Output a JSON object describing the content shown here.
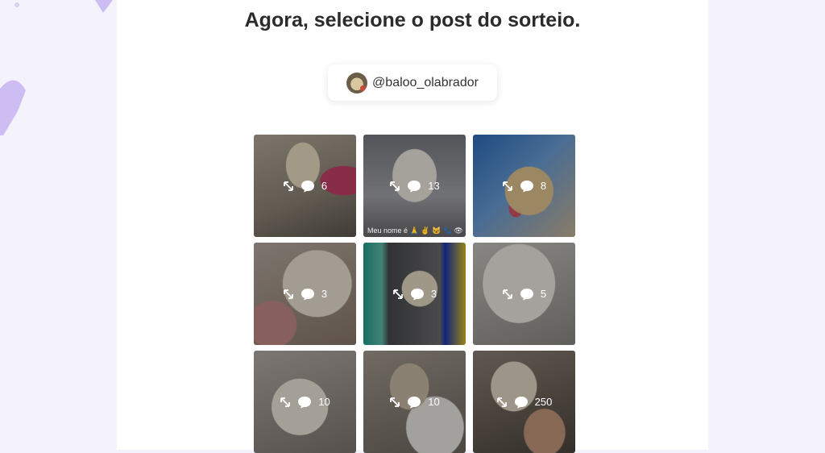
{
  "page": {
    "title": "Agora, selecione o post do sorteio."
  },
  "account": {
    "handle": "@baloo_olabrador"
  },
  "posts": [
    {
      "comments": "6"
    },
    {
      "comments": "13",
      "caption": "Meu nome é 🙏 ✌ 🐱 🐾 👁"
    },
    {
      "comments": "8"
    },
    {
      "comments": "3"
    },
    {
      "comments": "3"
    },
    {
      "comments": "5"
    },
    {
      "comments": "10"
    },
    {
      "comments": "10"
    },
    {
      "comments": "250"
    }
  ],
  "colors": {
    "background": "#f4f3fb",
    "accent_decor": "#cdbdf2",
    "panel": "#ffffff",
    "title_text": "#2b2b2b"
  },
  "icons": {
    "expand": "expand-icon",
    "comment": "comment-bubble-icon"
  }
}
